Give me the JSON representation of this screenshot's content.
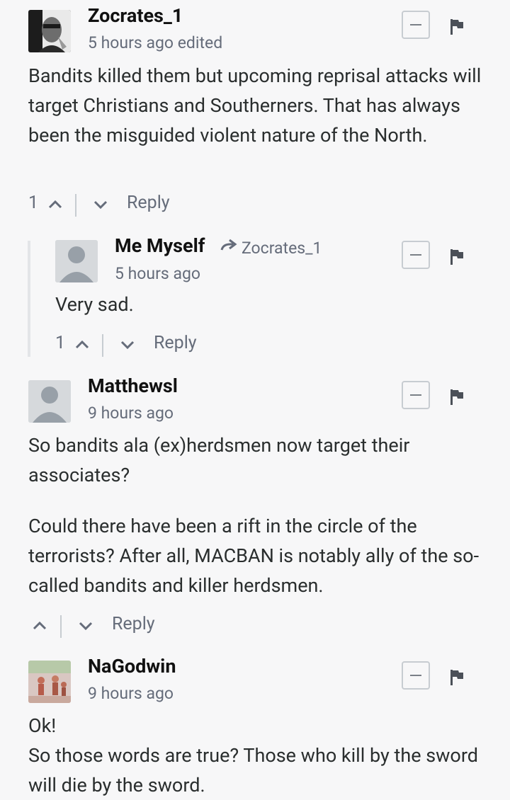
{
  "comments": [
    {
      "author": "Zocrates_1",
      "time": "5 hours ago",
      "edited": "edited",
      "paragraphs": [
        "Bandits killed them but upcoming reprisal attacks will target Christians and Southerners. That has always been the misguided violent nature of the North."
      ],
      "votes": "1",
      "reply_label": "Reply",
      "avatar_icon": "portrait-avatar"
    },
    {
      "author": "Me Myself",
      "reply_to": "Zocrates_1",
      "time": "5 hours ago",
      "paragraphs": [
        "Very sad."
      ],
      "votes": "1",
      "reply_label": "Reply",
      "avatar_icon": "default-user-avatar"
    },
    {
      "author": "Matthewsl",
      "time": "9 hours ago",
      "paragraphs": [
        "So bandits ala (ex)herdsmen now target their associates?",
        "Could there have been a rift in the circle of the terrorists? After all, MACBAN is notably ally of the so-called bandits and killer herdsmen."
      ],
      "votes": "",
      "reply_label": "Reply",
      "avatar_icon": "default-user-avatar"
    },
    {
      "author": "NaGodwin",
      "time": "9 hours ago",
      "paragraphs": [
        "Ok!",
        "So those words are true? Those who kill by the sword will die by the sword."
      ],
      "avatar_icon": "photo-avatar"
    }
  ],
  "icons": {
    "collapse": "minus-icon",
    "flag": "flag-icon",
    "upvote": "chevron-up-icon",
    "downvote": "chevron-down-icon",
    "reply_to": "arrow-right-icon"
  },
  "colors": {
    "background": "#f7f7f8",
    "text": "#2a2e2e",
    "muted": "#656c7a",
    "border": "#c7ccd1"
  }
}
